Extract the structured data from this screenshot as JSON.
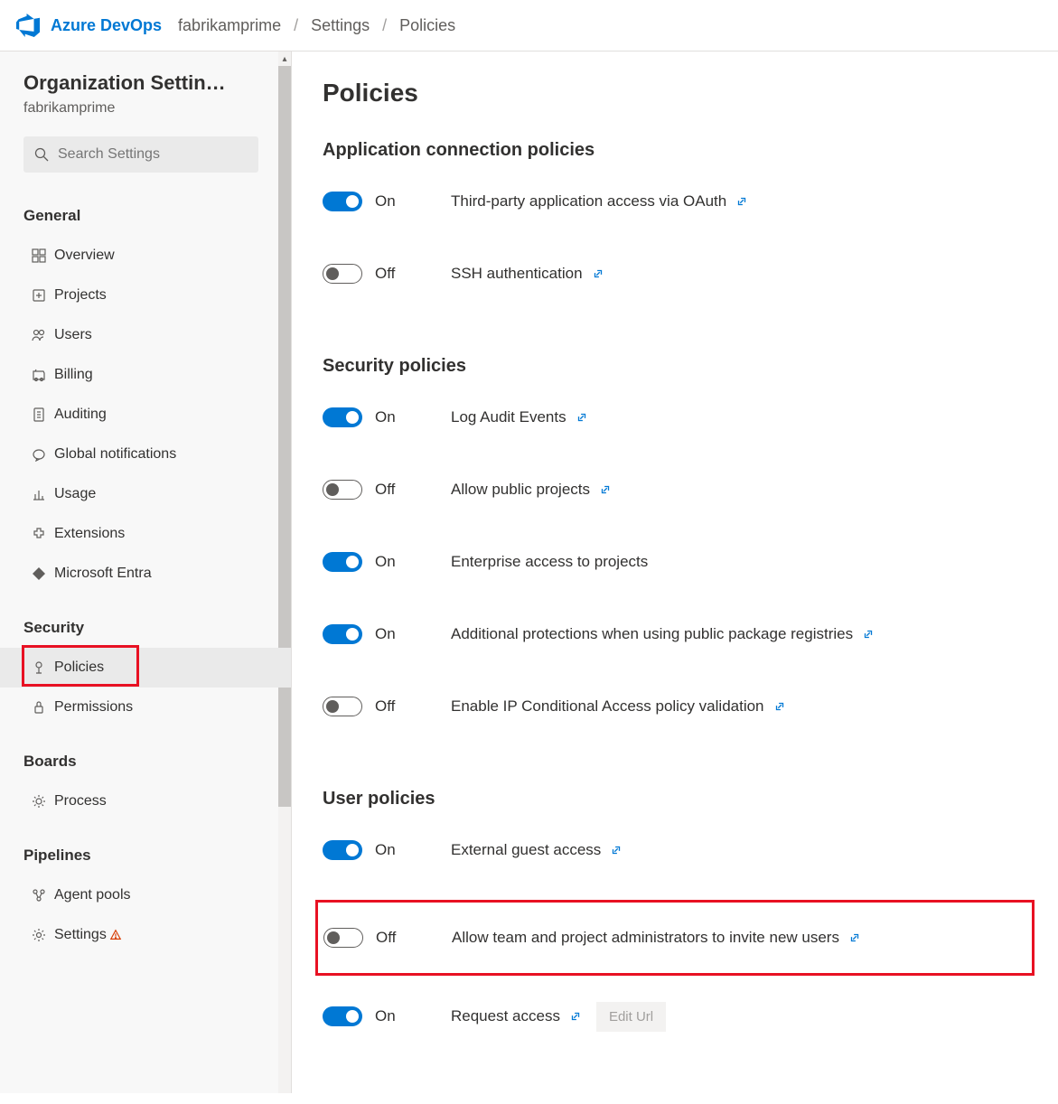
{
  "header": {
    "brand": "Azure DevOps",
    "crumb1": "fabrikamprime",
    "crumb2": "Settings",
    "crumb3": "Policies"
  },
  "sidebar": {
    "title": "Organization Settin…",
    "subtitle": "fabrikamprime",
    "search_placeholder": "Search Settings",
    "sections": {
      "general": {
        "label": "General",
        "items": [
          "Overview",
          "Projects",
          "Users",
          "Billing",
          "Auditing",
          "Global notifications",
          "Usage",
          "Extensions",
          "Microsoft Entra"
        ]
      },
      "security": {
        "label": "Security",
        "items": [
          "Policies",
          "Permissions"
        ]
      },
      "boards": {
        "label": "Boards",
        "items": [
          "Process"
        ]
      },
      "pipelines": {
        "label": "Pipelines",
        "items": [
          "Agent pools",
          "Settings"
        ]
      }
    }
  },
  "page": {
    "title": "Policies",
    "groups": [
      {
        "label": "Application connection policies",
        "items": [
          {
            "on": true,
            "label": "On",
            "desc": "Third-party application access via OAuth",
            "link": true
          },
          {
            "on": false,
            "label": "Off",
            "desc": "SSH authentication",
            "link": true
          }
        ]
      },
      {
        "label": "Security policies",
        "items": [
          {
            "on": true,
            "label": "On",
            "desc": "Log Audit Events",
            "link": true
          },
          {
            "on": false,
            "label": "Off",
            "desc": "Allow public projects",
            "link": true
          },
          {
            "on": true,
            "label": "On",
            "desc": "Enterprise access to projects",
            "link": false
          },
          {
            "on": true,
            "label": "On",
            "desc": "Additional protections when using public package registries",
            "link": true
          },
          {
            "on": false,
            "label": "Off",
            "desc": "Enable IP Conditional Access policy validation",
            "link": true
          }
        ]
      },
      {
        "label": "User policies",
        "items": [
          {
            "on": true,
            "label": "On",
            "desc": "External guest access",
            "link": true
          },
          {
            "on": false,
            "label": "Off",
            "desc": "Allow team and project administrators to invite new users",
            "link": true,
            "highlighted": true
          },
          {
            "on": true,
            "label": "On",
            "desc": "Request access",
            "link": true,
            "edit": "Edit Url"
          }
        ]
      }
    ]
  }
}
